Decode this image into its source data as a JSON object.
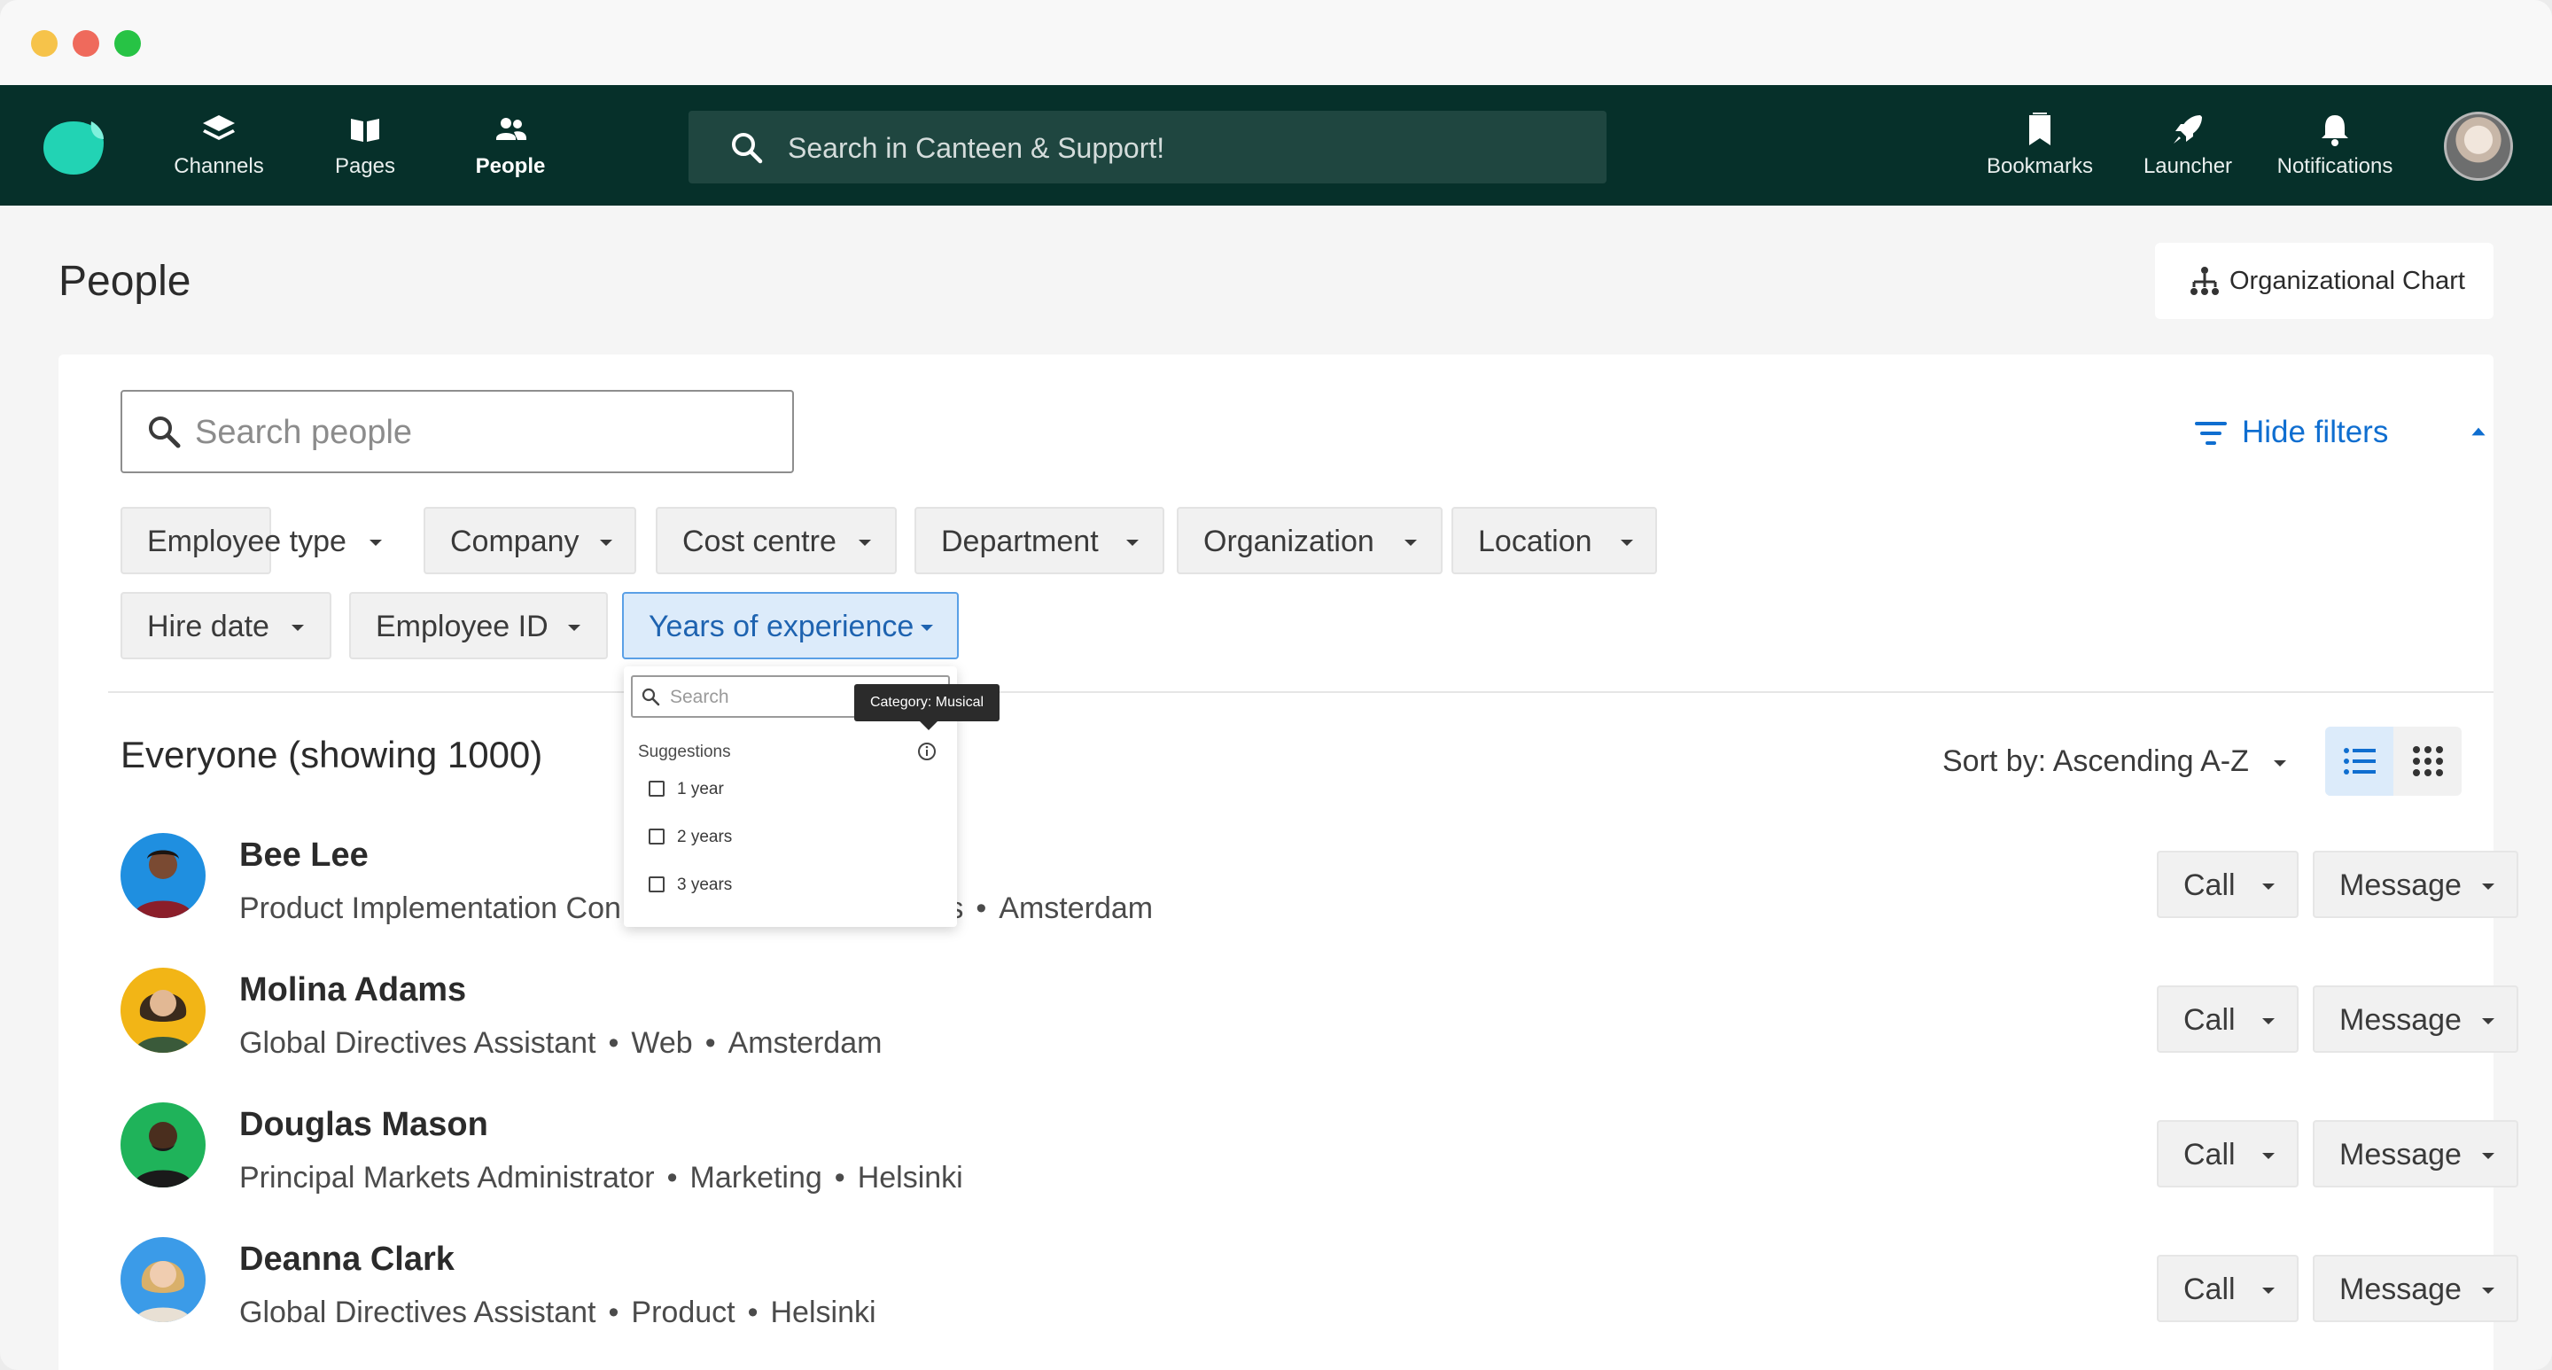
{
  "nav": {
    "items": [
      {
        "label": "Channels",
        "icon": "layers-icon"
      },
      {
        "label": "Pages",
        "icon": "book-icon"
      },
      {
        "label": "People",
        "icon": "people-icon",
        "active": true
      }
    ],
    "search_placeholder": "Search in Canteen & Support!",
    "right_items": [
      {
        "label": "Bookmarks",
        "icon": "bookmark-icon"
      },
      {
        "label": "Launcher",
        "icon": "rocket-icon"
      },
      {
        "label": "Notifications",
        "icon": "bell-icon"
      }
    ]
  },
  "page": {
    "title": "People",
    "org_chart_label": "Organizational Chart"
  },
  "filters": {
    "search_placeholder": "Search people",
    "hide_label": "Hide filters",
    "chips": [
      "Employee type",
      "Company",
      "Cost centre",
      "Department",
      "Organization",
      "Location",
      "Hire date",
      "Employee ID",
      "Years of experience"
    ],
    "active_chip": "Years of experience"
  },
  "dropdown": {
    "search_placeholder": "Search",
    "suggestions_label": "Suggestions",
    "tooltip": "Category: Musical",
    "options": [
      "1 year",
      "2 years",
      "3 years"
    ]
  },
  "list": {
    "heading": "Everyone (showing 1000)",
    "sort_label": "Sort by: Ascending A-Z",
    "call_label": "Call",
    "message_label": "Message",
    "people": [
      {
        "name": "Bee Lee",
        "role": "Product Implementation Con",
        "dept": "s",
        "location": "Amsterdam",
        "color": "#1f8fe0"
      },
      {
        "name": "Molina Adams",
        "role": "Global Directives Assistant",
        "dept": "Web",
        "location": "Amsterdam",
        "color": "#f2b516"
      },
      {
        "name": "Douglas Mason",
        "role": "Principal Markets Administrator",
        "dept": "Marketing",
        "location": "Helsinki",
        "color": "#1fb35a"
      },
      {
        "name": "Deanna Clark",
        "role": "Global Directives Assistant",
        "dept": "Product",
        "location": "Helsinki",
        "color": "#3b9be8"
      }
    ]
  },
  "colors": {
    "nav_bg": "#06302a",
    "accent": "#0f6ed0",
    "logo": "#22d3b4"
  }
}
